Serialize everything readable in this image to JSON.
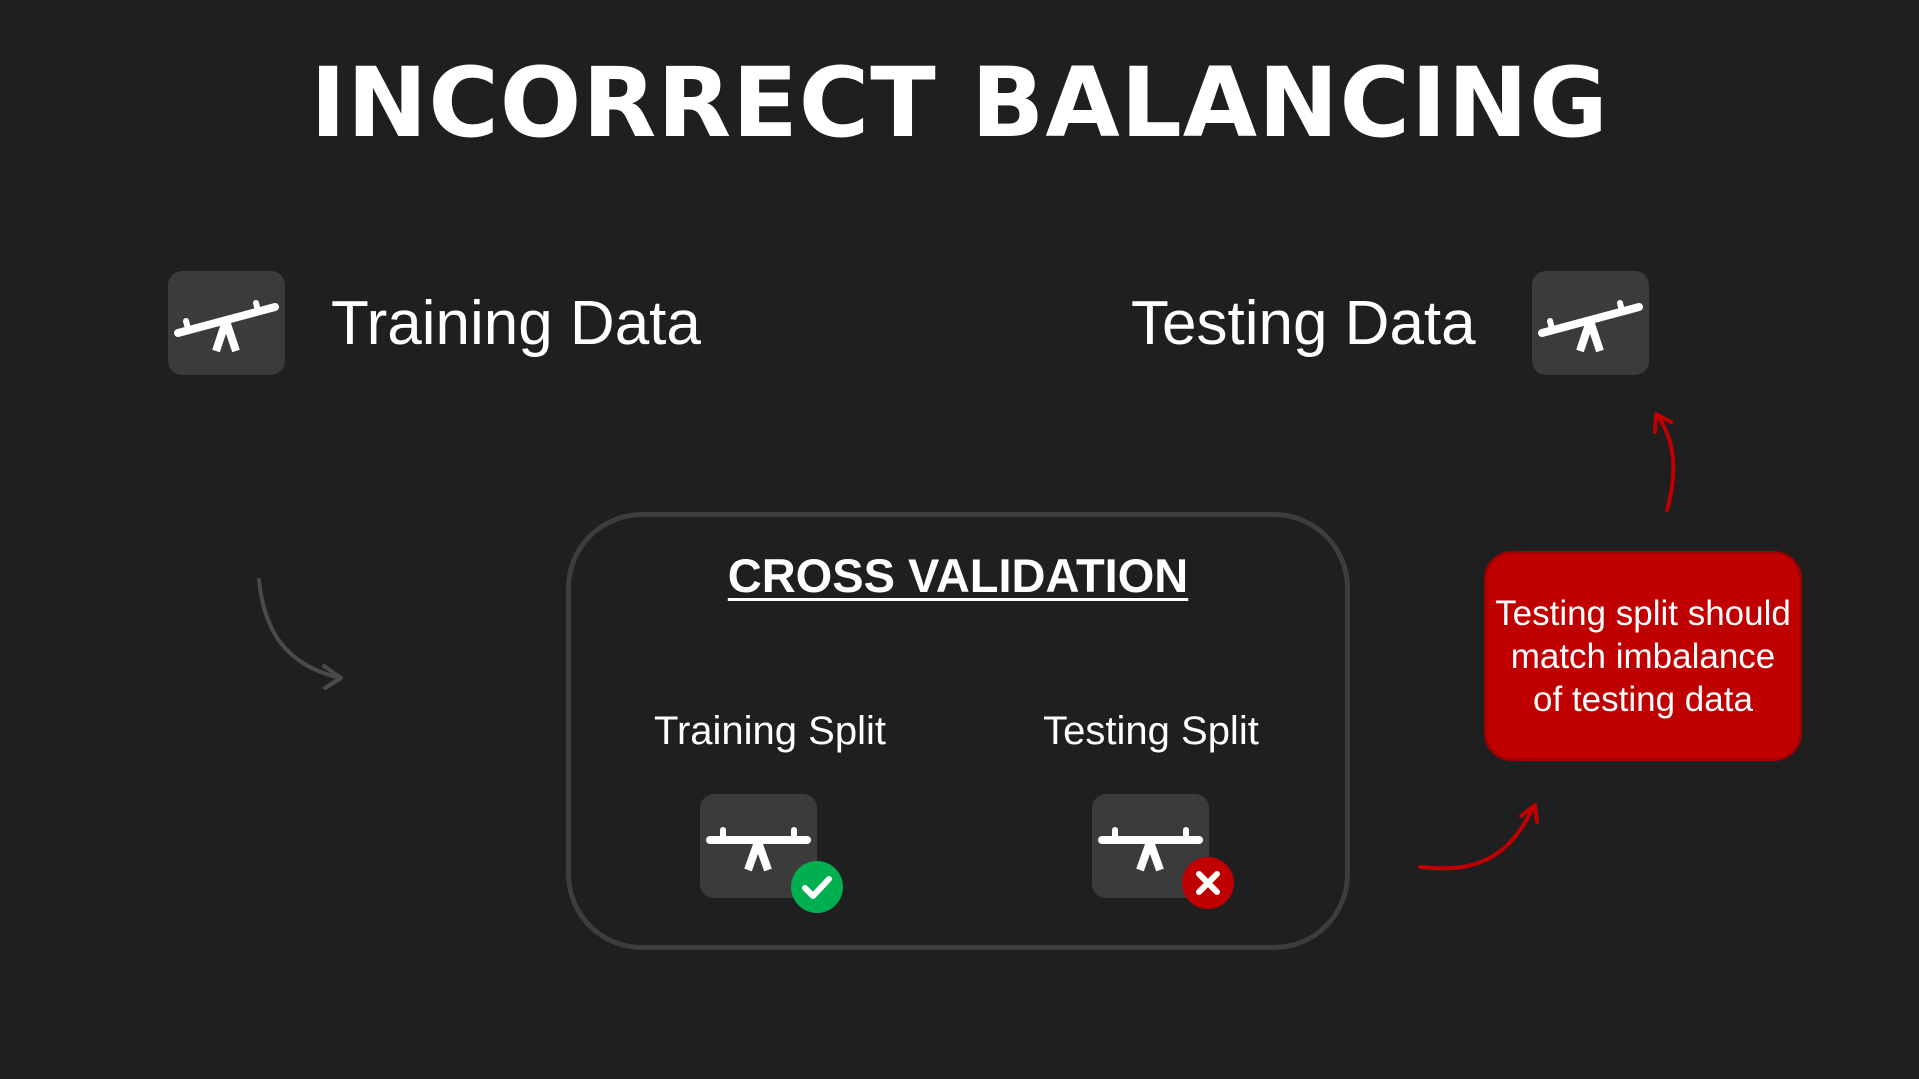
{
  "title": "INCORRECT BALANCING",
  "top": {
    "training_label": "Training Data",
    "testing_label": "Testing Data",
    "training_icon": "seesaw-icon",
    "testing_icon": "seesaw-icon"
  },
  "cross_validation": {
    "title": "CROSS VALIDATION",
    "training_split": {
      "label": "Training Split",
      "icon": "seesaw-icon",
      "status_icon": "check-icon",
      "status_color": "#00b050"
    },
    "testing_split": {
      "label": "Testing Split",
      "icon": "seesaw-icon",
      "status_icon": "x-icon",
      "status_color": "#c00000"
    }
  },
  "callout": {
    "text": "Testing split should match imbalance of testing data",
    "color": "#c00000"
  },
  "colors": {
    "background": "#1f1f1f",
    "icon_box": "#3b3b3b",
    "panel_border": "#3d3d3d",
    "accent_red": "#c00000",
    "accent_green": "#00b050"
  }
}
